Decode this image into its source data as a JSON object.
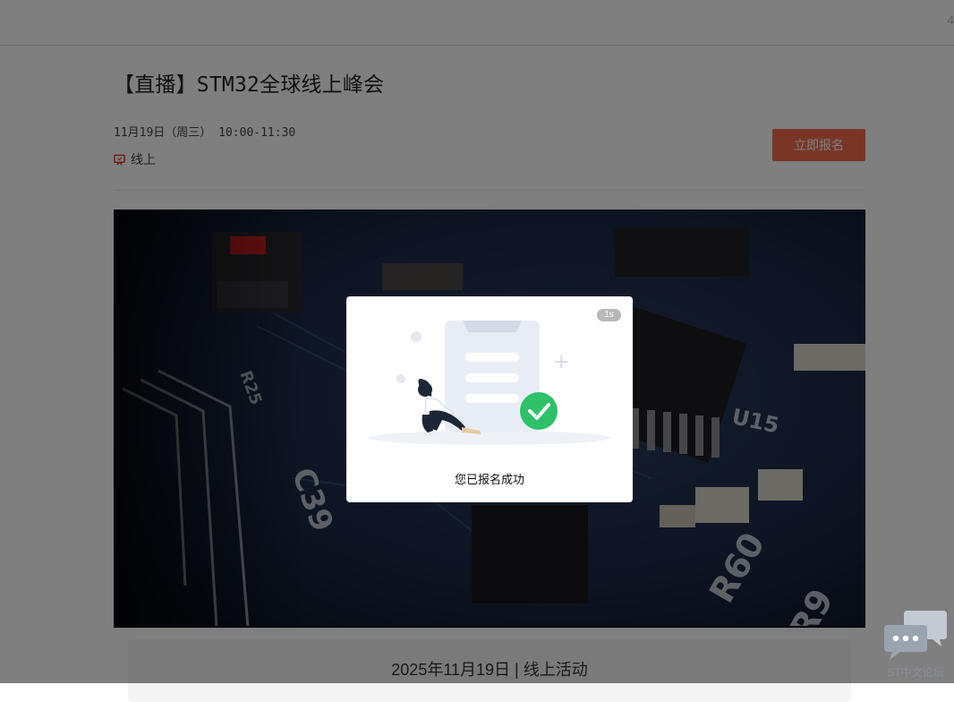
{
  "topbar": {
    "edge_glyph": "4"
  },
  "event": {
    "title": "【直播】STM32全球线上峰会",
    "datetime": "11月19日（周三） 10:00-11:30",
    "location": "线上",
    "register_label": "立即报名"
  },
  "info_card": {
    "text": "2025年11月19日 | 线上活动"
  },
  "modal": {
    "countdown": "1s",
    "message": "您已报名成功"
  },
  "forum_widget": {
    "label": "ST中文论坛"
  },
  "colors": {
    "accent": "#f26d4f",
    "success": "#2fc06a",
    "overlay": "rgba(0,0,0,0.5)"
  },
  "icons": [
    "screen-icon",
    "success-check-icon",
    "chat-bubbles-icon"
  ]
}
